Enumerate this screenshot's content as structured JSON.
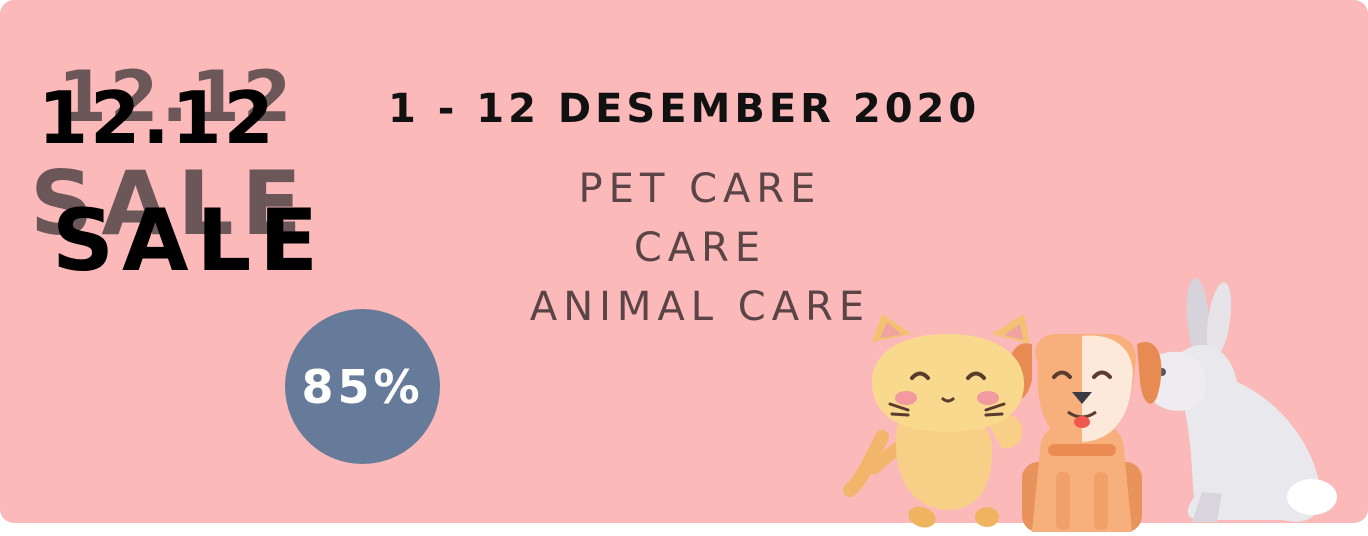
{
  "banner": {
    "event_number": "12.12",
    "event_word": "SALE",
    "date_range": "1 - 12 DESEMBER 2020",
    "categories": [
      "PET CARE",
      "CARE",
      "ANIMAL CARE"
    ],
    "discount": "85%"
  },
  "colors": {
    "background": "#fbb9ba",
    "discount_badge": "#667b99",
    "category_text": "#5a4446",
    "shadow_text": "#6b5658"
  },
  "illustration": {
    "icons": [
      "cat-icon",
      "dog-icon",
      "rabbit-icon"
    ]
  }
}
